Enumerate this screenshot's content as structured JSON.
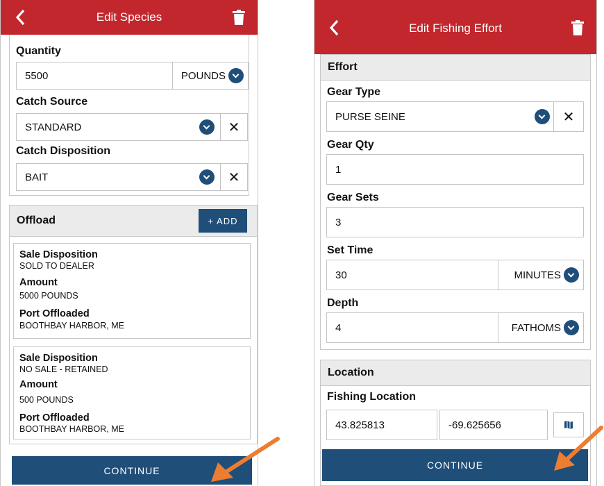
{
  "left": {
    "title": "Edit Species",
    "quantity_label": "Quantity",
    "quantity_value": "5500",
    "quantity_unit": "POUNDS",
    "catch_source_label": "Catch Source",
    "catch_source_value": "STANDARD",
    "catch_disposition_label": "Catch Disposition",
    "catch_disposition_value": "BAIT",
    "offload_label": "Offload",
    "add_label": "+ ADD",
    "offloads": [
      {
        "sale_label": "Sale Disposition",
        "sale_value": "SOLD TO DEALER",
        "amount_label": "Amount",
        "amount_value": "5000 POUNDS",
        "port_label": "Port Offloaded",
        "port_value": "BOOTHBAY HARBOR, ME"
      },
      {
        "sale_label": "Sale Disposition",
        "sale_value": "NO SALE - RETAINED",
        "amount_label": "Amount",
        "amount_value": "500 POUNDS",
        "port_label": "Port Offloaded",
        "port_value": "BOOTHBAY HARBOR, ME"
      }
    ],
    "continue_label": "CONTINUE"
  },
  "right": {
    "title": "Edit Fishing Effort",
    "effort_label": "Effort",
    "gear_type_label": "Gear Type",
    "gear_type_value": "PURSE SEINE",
    "gear_qty_label": "Gear Qty",
    "gear_qty_value": "1",
    "gear_sets_label": "Gear Sets",
    "gear_sets_value": "3",
    "set_time_label": "Set Time",
    "set_time_value": "30",
    "set_time_unit": "MINUTES",
    "depth_label": "Depth",
    "depth_value": "4",
    "depth_unit": "FATHOMS",
    "location_label": "Location",
    "fishing_location_label": "Fishing Location",
    "latitude": "43.825813",
    "longitude": "-69.625656",
    "continue_label": "CONTINUE"
  },
  "colors": {
    "header_red": "#c1272d",
    "primary_blue": "#1f4e79",
    "arrow_orange": "#ed7d31"
  },
  "icons": [
    "back-chevron-icon",
    "trash-icon",
    "dropdown-chevron-icon",
    "clear-x-icon",
    "map-icon",
    "arrow-pointer-icon"
  ]
}
